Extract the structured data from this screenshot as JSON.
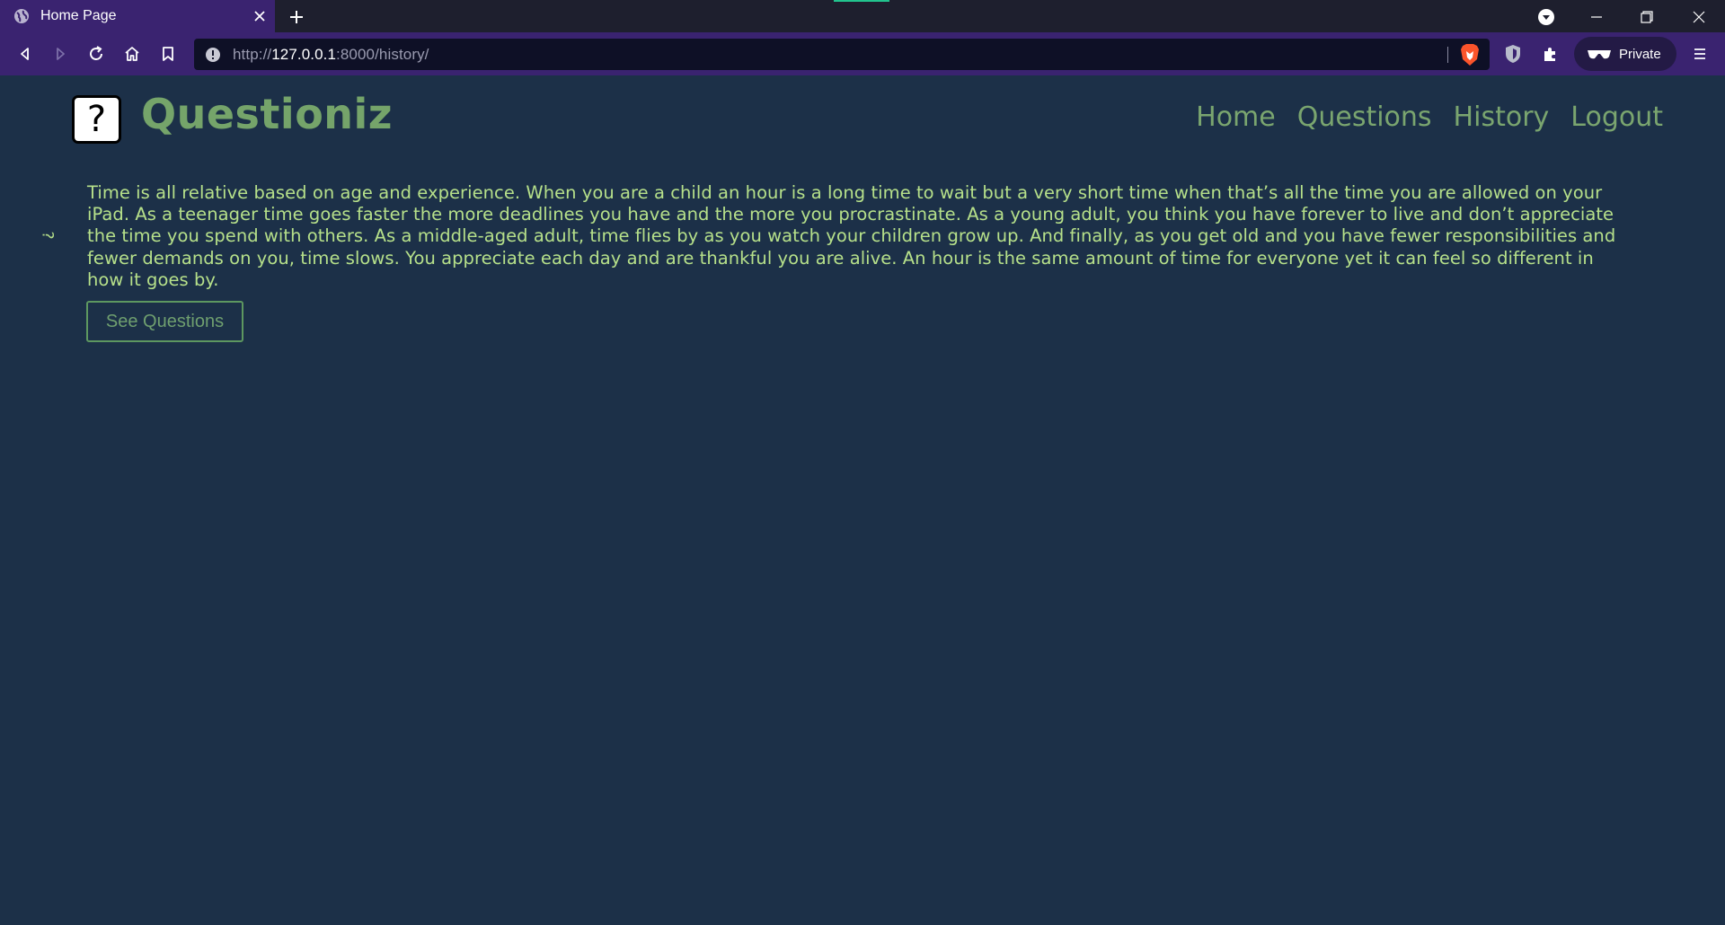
{
  "browser": {
    "tab_title": "Home Page",
    "url_prefix": "http://",
    "url_host": "127.0.0.1",
    "url_rest": ":8000/history/",
    "private_label": "Private"
  },
  "header": {
    "logo_symbol": "?",
    "brand": "Questioniz",
    "nav": {
      "home": "Home",
      "questions": "Questions",
      "history": "History",
      "logout": "Logout"
    }
  },
  "main": {
    "side_mark": "?",
    "story_text": "Time is all relative based on age and experience. When you are a child an hour is a long time to wait but a very short time when that’s all the time you are allowed on your iPad. As a teenager time goes faster the more deadlines you have and the more you procrastinate. As a young adult, you think you have forever to live and don’t appreciate the time you spend with others. As a middle-aged adult, time flies by as you watch your children grow up. And finally, as you get old and you have fewer responsibilities and fewer demands on you, time slows. You appreciate each day and are thankful you are alive. An hour is the same amount of time for everyone yet it can feel so different in how it goes by.",
    "see_questions_label": "See Questions"
  },
  "colors": {
    "page_background": "#1c3048",
    "brand_green": "#75a46a",
    "text_green": "#b6e08a",
    "chrome_purple": "#3a2370"
  },
  "icons": [
    "globe-icon",
    "close-icon",
    "plus-icon",
    "download-icon",
    "minimize-icon",
    "restore-icon",
    "back-icon",
    "forward-icon",
    "reload-icon",
    "home-icon",
    "bookmark-icon",
    "info-icon",
    "brave-lion-icon",
    "shield-icon",
    "extensions-icon",
    "private-glasses-icon",
    "menu-icon"
  ]
}
